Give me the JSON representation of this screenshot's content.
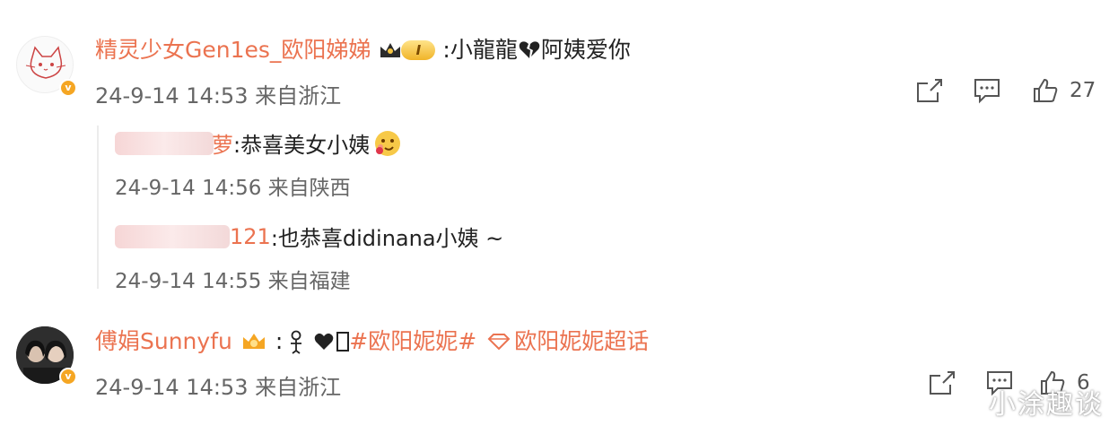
{
  "comment1": {
    "username": "精灵少女Gen1es_欧阳娣娣",
    "fan_badge_level": "I",
    "content": ":小龍龍",
    "content_after": "阿姨爱你",
    "time": "24-9-14 14:53 来自浙江",
    "like_count": "27"
  },
  "replies": [
    {
      "name_visible": "萝",
      "content": ":恭喜美女小姨",
      "time": "24-9-14 14:56 来自陕西"
    },
    {
      "name_visible": "121",
      "content": ":也恭喜didinana小姨 ~",
      "time": "24-9-14 14:55 来自福建"
    }
  ],
  "comment2": {
    "username": "傅娟Sunnyfu",
    "content_prefix": ":",
    "topic": "#欧阳妮妮#",
    "supertopic": "欧阳妮妮超话",
    "time": "24-9-14 14:53 来自浙江",
    "like_count": "6"
  },
  "watermark": "小涂趣谈",
  "colors": {
    "accent": "#eb7350",
    "vip": "#f5a623",
    "icon": "#555555"
  }
}
